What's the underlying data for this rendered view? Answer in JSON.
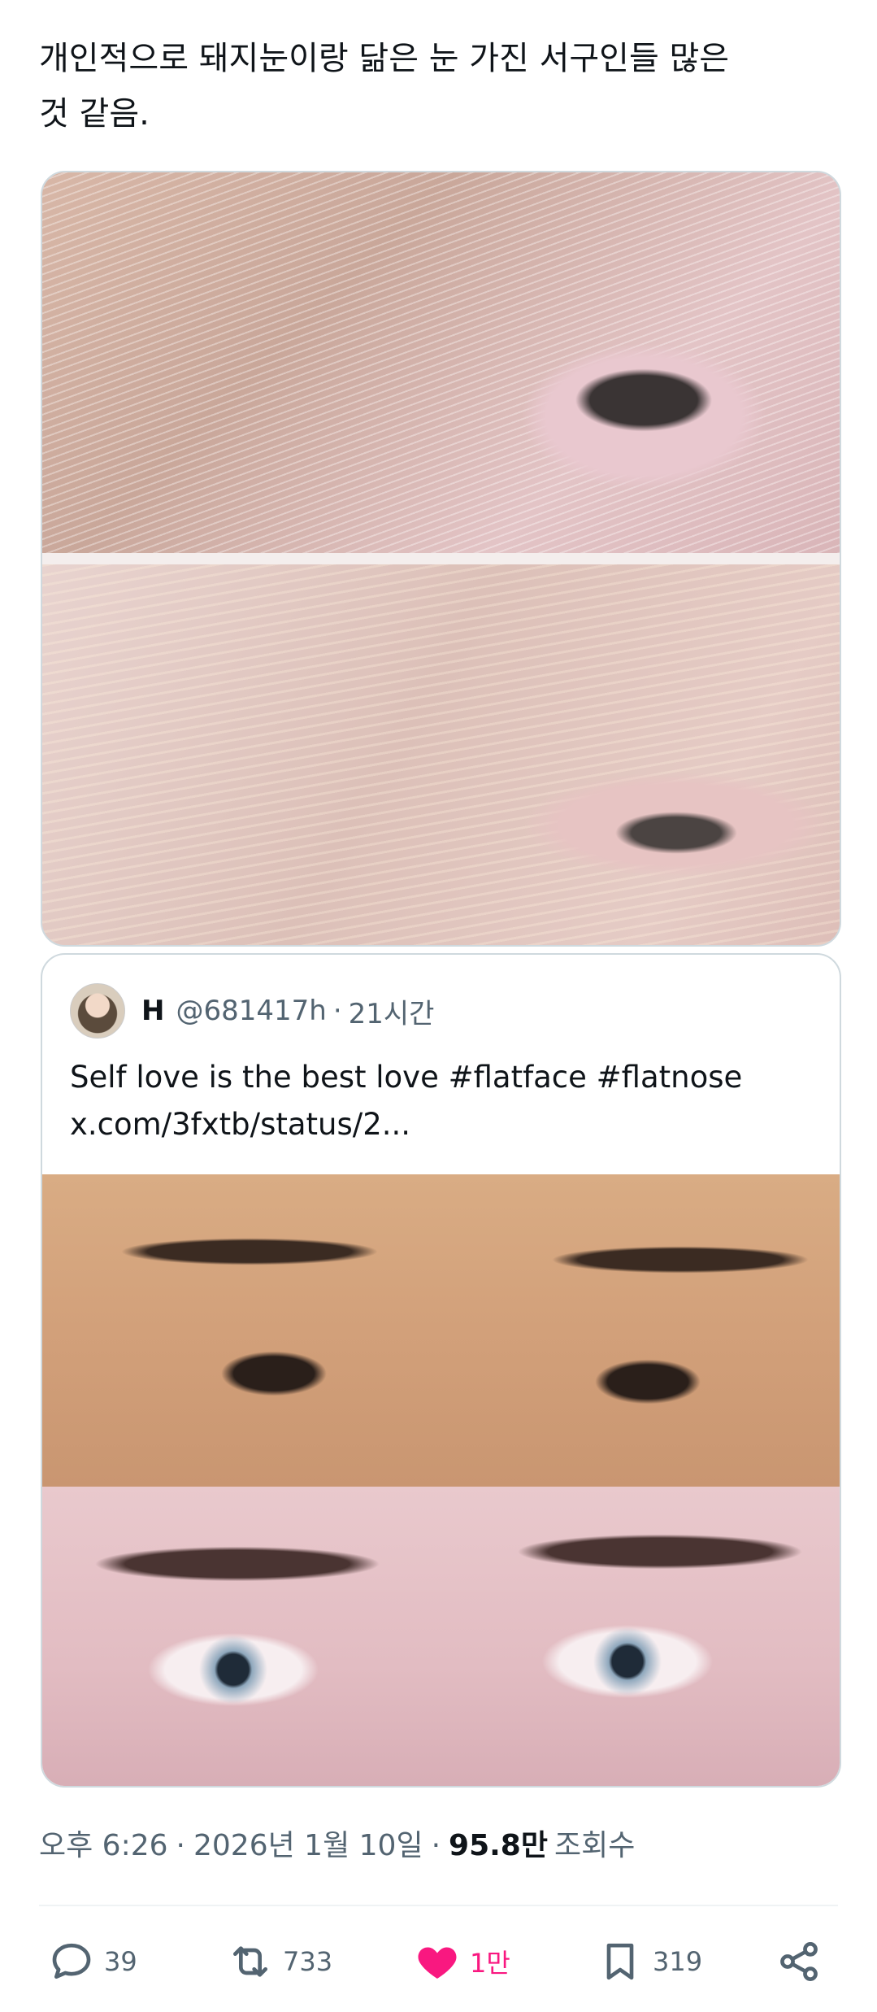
{
  "tweet": {
    "text": "개인적으로 돼지눈이랑 닮은 눈 가진 서구인들 많은\n것 같음."
  },
  "quoted": {
    "name": "H",
    "handle": "@681417h",
    "separator": "·",
    "time": "21시간",
    "text": "Self love is the best love #flatface #flatnose",
    "link": "x.com/3fxtb/status/2..."
  },
  "meta": {
    "time": "오후 6:26",
    "separator1": "·",
    "date": "2026년 1월 10일",
    "separator2": "·",
    "views": "95.8만",
    "views_label": "조회수"
  },
  "actions": {
    "replies": "39",
    "retweets": "733",
    "likes": "1만",
    "bookmarks": "319"
  },
  "colors": {
    "like_active": "#f91880",
    "text_secondary": "#536471",
    "border": "#cfd9de"
  },
  "icons": {
    "reply": "reply-icon",
    "retweet": "retweet-icon",
    "like": "heart-icon",
    "bookmark": "bookmark-icon",
    "share": "share-icon"
  }
}
